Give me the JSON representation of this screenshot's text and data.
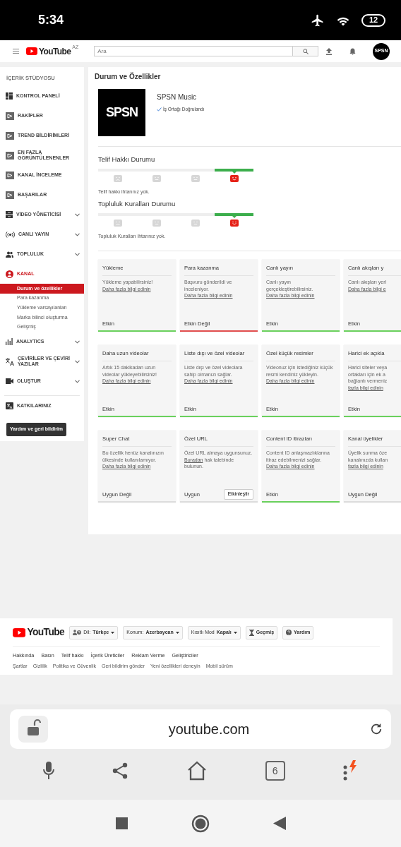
{
  "status_bar": {
    "time": "5:34",
    "battery": "12"
  },
  "header": {
    "logo": "YouTube",
    "region": "AZ",
    "search": {
      "placeholder": "Ara"
    },
    "avatar": "SPSN"
  },
  "sidebar": {
    "title": "İÇERİK STÜDYOSU",
    "items": [
      {
        "label": "KONTROL PANELİ",
        "kind": "dashboard",
        "expandable": false,
        "selected": false
      },
      {
        "label": "RAKİPLER",
        "kind": "plugin",
        "expandable": false,
        "selected": false
      },
      {
        "label": "TREND BİLDİRİMLERİ",
        "kind": "plugin",
        "expandable": false,
        "selected": false
      },
      {
        "label": "EN FAZLA GÖRÜNTÜLENENLER",
        "kind": "plugin",
        "expandable": false,
        "selected": false
      },
      {
        "label": "KANAL İNCELEME",
        "kind": "plugin",
        "expandable": false,
        "selected": false
      },
      {
        "label": "BAŞARILAR",
        "kind": "plugin",
        "expandable": false,
        "selected": false
      },
      {
        "label": "VİDEO YÖNETİCİSİ",
        "kind": "videos",
        "expandable": true,
        "selected": false
      },
      {
        "label": "CANLI YAYIN",
        "kind": "live",
        "expandable": true,
        "selected": false
      },
      {
        "label": "TOPLULUK",
        "kind": "community",
        "expandable": true,
        "selected": false
      },
      {
        "label": "KANAL",
        "kind": "channel",
        "expandable": false,
        "selected": true,
        "children": [
          {
            "label": "Durum ve özellikler",
            "selected": true
          },
          {
            "label": "Para kazanma",
            "selected": false
          },
          {
            "label": "Yükleme varsayılanları",
            "selected": false
          },
          {
            "label": "Marka bilinci oluşturma",
            "selected": false
          },
          {
            "label": "Gelişmiş",
            "selected": false
          }
        ]
      },
      {
        "label": "ANALYTICS",
        "kind": "analytics",
        "expandable": true,
        "selected": false
      },
      {
        "label": "ÇEVİRİLER VE ÇEVİRİ YAZILAR",
        "kind": "translate",
        "expandable": true,
        "selected": false
      },
      {
        "label": "OLUŞTUR",
        "kind": "create",
        "expandable": true,
        "selected": false
      },
      {
        "label": "KATKILARINIZ",
        "kind": "contributions",
        "expandable": false,
        "selected": false
      }
    ],
    "help_button": "Yardım ve geri bildirim"
  },
  "main": {
    "title": "Durum ve Özellikler",
    "channel": {
      "logo_text": "SPSN",
      "name": "SPSN Music",
      "verified": "İş Ortağı Doğrulandı"
    },
    "statuses": [
      {
        "title": "Telif Hakkı Durumu",
        "note": "Telif hakkı ihtarınız yok.",
        "segments": [
          {
            "kind": "sad",
            "selected": false
          },
          {
            "kind": "meh",
            "selected": false
          },
          {
            "kind": "meh",
            "selected": false
          },
          {
            "kind": "happy",
            "selected": true
          }
        ]
      },
      {
        "title": "Topluluk Kuralları Durumu",
        "note": "Topluluk Kuralları ihtarınız yok.",
        "segments": [
          {
            "kind": "sad",
            "selected": false
          },
          {
            "kind": "meh",
            "selected": false
          },
          {
            "kind": "meh",
            "selected": false
          },
          {
            "kind": "happy",
            "selected": true
          }
        ]
      }
    ],
    "features": [
      {
        "title": "Yükleme",
        "description": "Yükleme yapabilirsiniz!",
        "link": "Daha fazla bilgi edinin",
        "status": "Etkin",
        "kind": "active"
      },
      {
        "title": "Para kazanma",
        "description": "Başvuru gönderildi ve inceleniyor.",
        "link": "Daha fazla bilgi edinin",
        "status": "Etkin Değil",
        "kind": "inactive"
      },
      {
        "title": "Canlı yayın",
        "description": "Canlı yayın gerçekleştirebilirsiniz.",
        "link": "Daha fazla bilgi edinin",
        "status": "Etkin",
        "kind": "active"
      },
      {
        "title": "Canlı akışları y",
        "lines": [
          "Canlı akışları yerl"
        ],
        "link": "Daha fazla bilgi e",
        "status": "Etkin",
        "kind": "active"
      },
      {
        "title": "Daha uzun videolar",
        "description": "Artık 15 dakikadan uzun videolar yükleyebilirsiniz!",
        "link": "Daha fazla bilgi edinin",
        "status": "Etkin",
        "kind": "active"
      },
      {
        "title": "Liste dışı ve özel videolar",
        "description": "Liste dışı ve özel videolara sahip olmanızı sağlar.",
        "link": "Daha fazla bilgi edinin",
        "status": "Etkin",
        "kind": "active"
      },
      {
        "title": "Özel küçük resimler",
        "description": "Videonuz için istediğiniz küçük resmi kendiniz yükleyin.",
        "link": "Daha fazla bilgi edinin",
        "status": "Etkin",
        "kind": "active"
      },
      {
        "title": "Harici ek açıkla",
        "lines": [
          "Harici siteler veya",
          "ortakları için ek a",
          "bağlantı vermeniz"
        ],
        "link": "fazla bilgi edinin",
        "status": "Etkin",
        "kind": "active"
      },
      {
        "title": "Super Chat",
        "description": "Bu özellik henüz kanalınızın ülkesinde kullanılamıyor.",
        "link": "Daha fazla bilgi edinin",
        "status": "Uygun Değil",
        "kind": "unavailable"
      },
      {
        "title": "Özel URL",
        "description": "Özel URL almaya uygunsunuz.",
        "link": "Buradan",
        "description_after": "hak talebinde bulunun.",
        "status": "Uygun",
        "kind": "unavailable",
        "action": "Etkinleştir"
      },
      {
        "title": "Content ID itirazları",
        "description": "Content ID anlaşmazlıklarına itiraz edebilmenizi sağlar.",
        "link": "Daha fazla bilgi edinin",
        "status": "Etkin",
        "kind": "active"
      },
      {
        "title": "Kanal üyelikler",
        "lines": [
          "Üyelik sunma öze",
          "kanalınızda kullan"
        ],
        "link": "fazla bilgi edinin",
        "status": "Uygun Değil",
        "kind": "unavailable"
      }
    ]
  },
  "footer": {
    "logo": "YouTube",
    "menus": [
      {
        "kind": "language",
        "label": "Dil:",
        "value": "Türkçe",
        "dropdown": true
      },
      {
        "kind": "location",
        "label": "Konum:",
        "value": "Azerbaycan",
        "dropdown": true
      },
      {
        "kind": "restricted",
        "label": "Kısıtlı Mod",
        "value": "Kapalı",
        "dropdown": true
      },
      {
        "kind": "history",
        "value": "Geçmiş",
        "dropdown": false
      },
      {
        "kind": "help",
        "value": "Yardım",
        "dropdown": false
      }
    ],
    "links": [
      "Hakkında",
      "Basın",
      "Telif hakkı",
      "İçerik Üreticiler",
      "Reklam Verme",
      "Geliştiriciler"
    ],
    "small_links": [
      "Şartlar",
      "Gizlilik",
      "Politika ve Güvenlik",
      "Geri bildirim gönder",
      "Yeni özellikleri deneyin",
      "Mobil sürüm"
    ]
  },
  "browser": {
    "url": "youtube.com",
    "tab_count": "6"
  }
}
